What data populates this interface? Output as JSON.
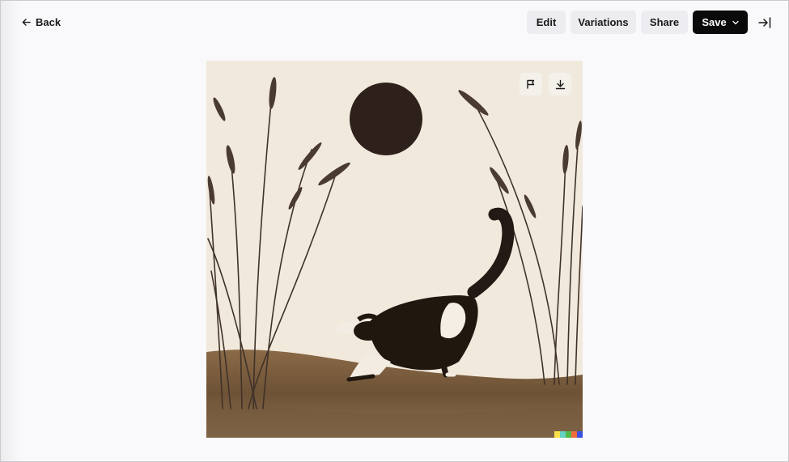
{
  "header": {
    "back_label": "Back",
    "edit_label": "Edit",
    "variations_label": "Variations",
    "share_label": "Share",
    "save_label": "Save"
  },
  "image": {
    "icons": {
      "flag": "flag-icon",
      "download": "download-icon"
    },
    "signature_colors": [
      "#f7e04a",
      "#66d1c1",
      "#52b847",
      "#f06a3a",
      "#3c50e0"
    ]
  },
  "colors": {
    "background": "#f9f9fb",
    "button_bg": "#ececf1",
    "save_bg": "#0a0a0a",
    "save_text": "#ffffff"
  }
}
